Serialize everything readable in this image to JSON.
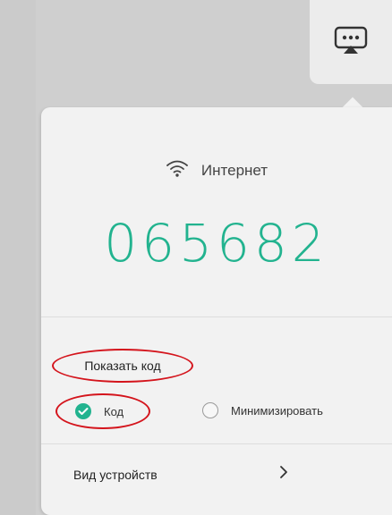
{
  "cast_button": {
    "icon": "cast-dots-icon"
  },
  "network": {
    "icon": "wifi-icon",
    "label": "Интернет"
  },
  "pairing": {
    "code": "065682"
  },
  "show_code": {
    "label": "Показать код"
  },
  "display_options": [
    {
      "label": "Код",
      "selected": true
    },
    {
      "label": "Минимизировать",
      "selected": false
    }
  ],
  "devices": {
    "label": "Вид устройств",
    "icon": "chevron-right-icon"
  },
  "colors": {
    "accent": "#22b38f",
    "highlight": "#d4141c"
  }
}
